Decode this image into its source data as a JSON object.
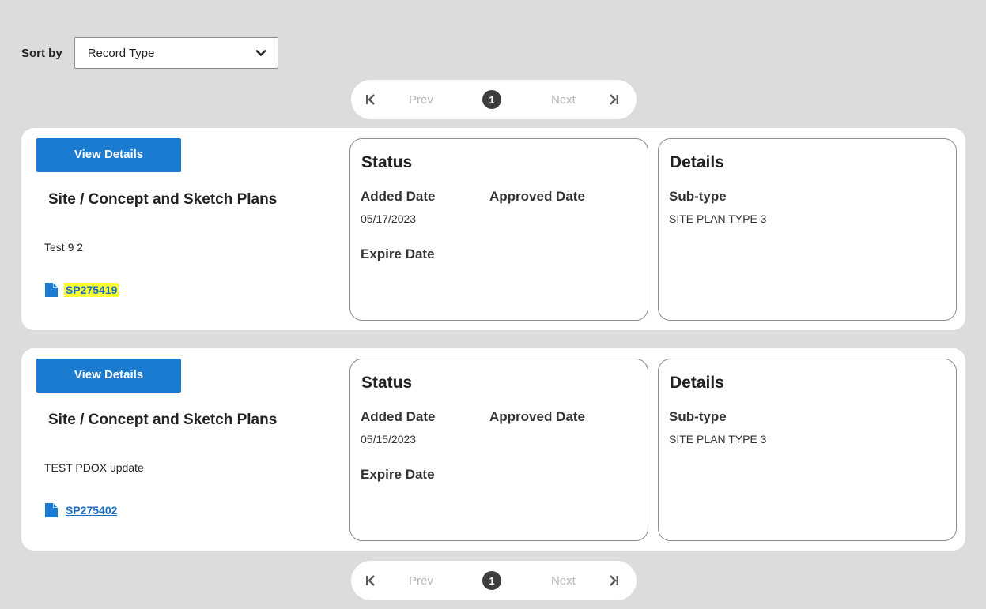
{
  "sort": {
    "label": "Sort by",
    "selected": "Record Type"
  },
  "pager": {
    "prev": "Prev",
    "page": "1",
    "next": "Next"
  },
  "records": [
    {
      "view_label": "View Details",
      "title": "Site / Concept and Sketch Plans",
      "description": "Test 9 2",
      "record_id": "SP275419",
      "status": {
        "heading": "Status",
        "added_label": "Added Date",
        "added_value": "05/17/2023",
        "approved_label": "Approved Date",
        "expire_label": "Expire Date"
      },
      "details": {
        "heading": "Details",
        "subtype_label": "Sub-type",
        "subtype_value": "SITE PLAN TYPE 3"
      }
    },
    {
      "view_label": "View Details",
      "title": "Site / Concept and Sketch Plans",
      "description": "TEST PDOX update",
      "record_id": "SP275402",
      "status": {
        "heading": "Status",
        "added_label": "Added Date",
        "added_value": "05/15/2023",
        "approved_label": "Approved Date",
        "expire_label": "Expire Date"
      },
      "details": {
        "heading": "Details",
        "subtype_label": "Sub-type",
        "subtype_value": "SITE PLAN TYPE 3"
      }
    }
  ],
  "colors": {
    "background": "#dcdcdc",
    "primary": "#1a7bd1",
    "link": "#1a6fc5",
    "highlight": "#ffff33"
  },
  "icons": [
    "chevron-down-icon",
    "first-page-icon",
    "last-page-icon",
    "document-icon"
  ]
}
